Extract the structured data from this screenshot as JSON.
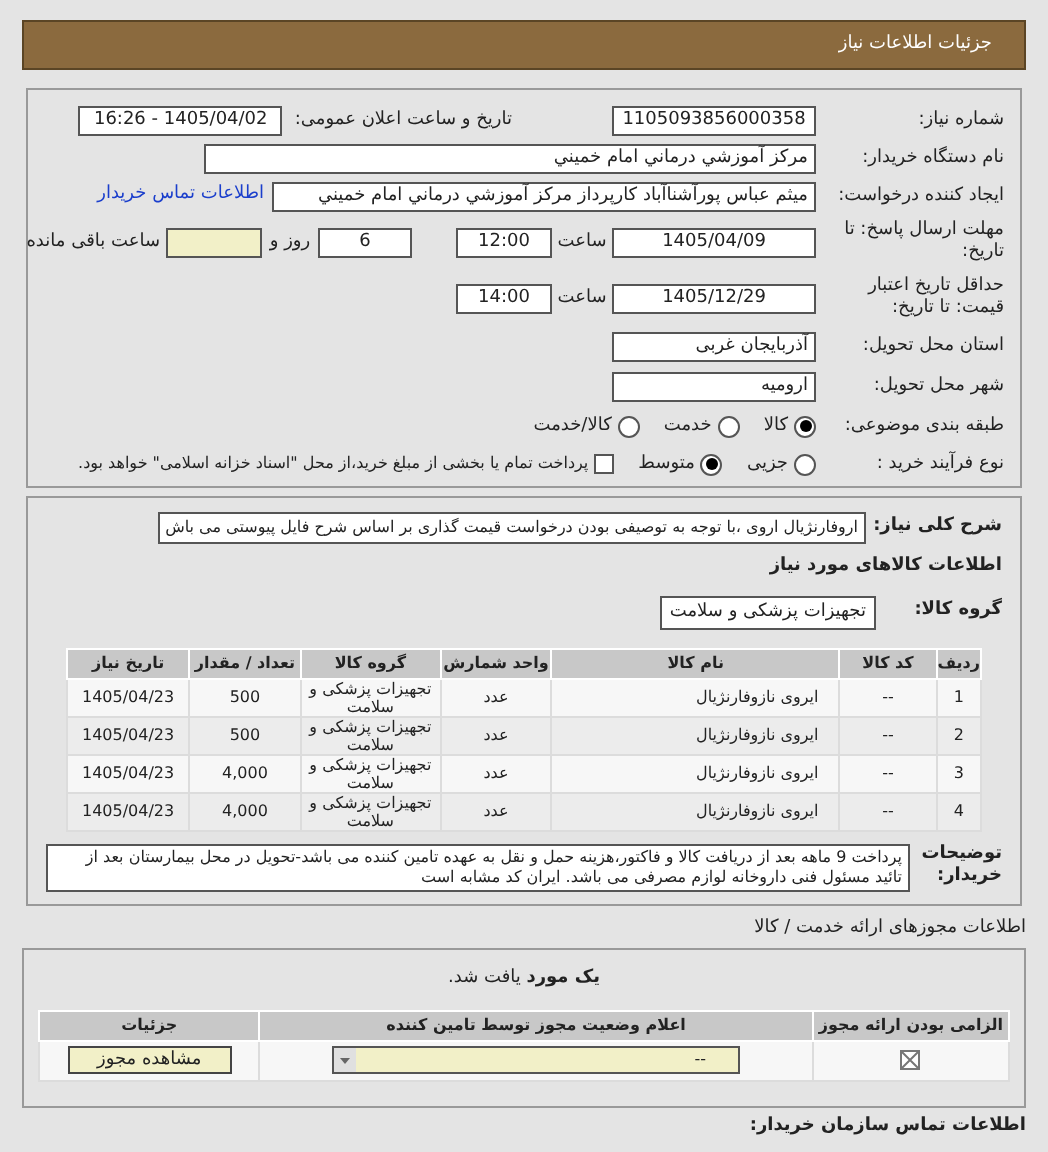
{
  "header": {
    "title": "جزئیات اطلاعات نیاز"
  },
  "need_number": {
    "label": "شماره نیاز:",
    "value": "1105093856000358"
  },
  "announce": {
    "label": "تاریخ و ساعت اعلان عمومی:",
    "value": "1405/04/02 - 16:26"
  },
  "buyer_org": {
    "label": "نام دستگاه خریدار:",
    "value": "مرکز آموزشي درماني امام خميني"
  },
  "requester": {
    "label": "ایجاد کننده درخواست:",
    "value": "میثم عباس پورآشناآباد کارپرداز مرکز آموزشي درماني امام خميني",
    "link": "اطلاعات تماس خریدار"
  },
  "deadline": {
    "label": "مهلت ارسال پاسخ: تا تاریخ:",
    "date": "1405/04/09",
    "time_label": "ساعت",
    "time": "12:00",
    "days": "6",
    "days_label": "روز و",
    "remaining_label": "ساعت باقی مانده"
  },
  "validity": {
    "label": "حداقل تاریخ اعتبار قیمت: تا تاریخ:",
    "date": "1405/12/29",
    "time_label": "ساعت",
    "time": "14:00"
  },
  "province": {
    "label": "استان محل تحویل:",
    "value": "آذربایجان غربی"
  },
  "city": {
    "label": "شهر محل تحویل:",
    "value": "ارومیه"
  },
  "category": {
    "label": "طبقه بندی موضوعی:",
    "options": [
      {
        "label": "کالا",
        "selected": true
      },
      {
        "label": "خدمت",
        "selected": false
      },
      {
        "label": "کالا/خدمت",
        "selected": false
      }
    ]
  },
  "process": {
    "label": "نوع فرآیند خرید :",
    "options": [
      {
        "label": "جزیی",
        "selected": false
      },
      {
        "label": "متوسط",
        "selected": true
      }
    ],
    "payment": {
      "label": "پرداخت تمام یا بخشی از مبلغ خرید،از محل \"اسناد خزانه اسلامی\" خواهد بود.",
      "checked": false
    }
  },
  "description": {
    "label": "شرح کلی نیاز:",
    "value": "اروفارنژیال اروی ،با توجه به توصیفی بودن درخواست قیمت گذاری بر اساس شرح فایل پیوستی می باش"
  },
  "goods_heading": "اطلاعات کالاهای مورد نیاز",
  "goods_group": {
    "label": "گروه کالا:",
    "value": "تجهیزات پزشکی و سلامت"
  },
  "goods_table": {
    "columns": [
      "ردیف",
      "کد کالا",
      "نام کالا",
      "واحد شمارش",
      "گروه کالا",
      "تعداد / مقدار",
      "تاریخ نیاز"
    ],
    "rows": [
      [
        "1",
        "--",
        "ایروی نازوفارنژیال",
        "عدد",
        "تجهیزات پزشکی و سلامت",
        "500",
        "1405/04/23"
      ],
      [
        "2",
        "--",
        "ایروی نازوفارنژیال",
        "عدد",
        "تجهیزات پزشکی و سلامت",
        "500",
        "1405/04/23"
      ],
      [
        "3",
        "--",
        "ایروی نازوفارنژیال",
        "عدد",
        "تجهیزات پزشکی و سلامت",
        "4,000",
        "1405/04/23"
      ],
      [
        "4",
        "--",
        "ایروی نازوفارنژیال",
        "عدد",
        "تجهیزات پزشکی و سلامت",
        "4,000",
        "1405/04/23"
      ]
    ]
  },
  "buyer_notes": {
    "label": "توضیحات خریدار:",
    "value": "پرداخت 9 ماهه بعد از دریافت کالا و فاکتور،هزینه حمل و نقل به عهده تامین کننده می باشد-تحویل در محل بیمارستان بعد از تائید مسئول فنی داروخانه لوازم مصرفی می باشد. ایران کد مشابه است"
  },
  "licenses": {
    "title": "اطلاعات مجوزهای ارائه خدمت / کالا",
    "found": "**یک مورد** یافت شد.",
    "columns": [
      "الزامی بودن ارائه مجوز",
      "اعلام وضعیت مجوز توسط تامین کننده",
      "جزئیات"
    ],
    "rows": [
      {
        "required": true,
        "status": "--",
        "button": "مشاهده مجوز"
      }
    ]
  },
  "contact_heading": "اطلاعات تماس سازمان خریدار:"
}
